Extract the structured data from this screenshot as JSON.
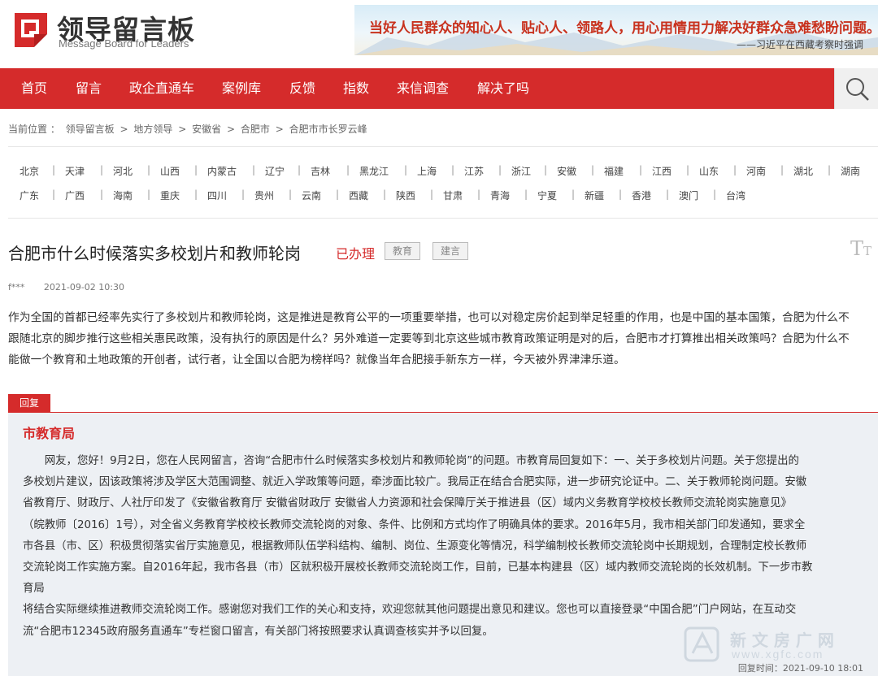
{
  "header": {
    "title": "领导留言板",
    "subtitle": "Message Board for Leaders",
    "slogan": "当好人民群众的知心人、贴心人、领路人，用心用情用力解决好群众急难愁盼问题。",
    "slogan_signature": "——习近平在西藏考察时强调"
  },
  "nav": {
    "items": [
      "首页",
      "留言",
      "政企直通车",
      "案例库",
      "反馈",
      "指数",
      "来信调查",
      "解决了吗"
    ]
  },
  "breadcrumb": {
    "prefix": "当前位置 ：",
    "items": [
      "领导留言板",
      "地方领导",
      "安徽省",
      "合肥市",
      "合肥市市长罗云峰"
    ],
    "separator": ">"
  },
  "provinces": {
    "row1": [
      "北京",
      "天津",
      "河北",
      "山西",
      "内蒙古",
      "辽宁",
      "吉林",
      "黑龙江",
      "上海",
      "江苏",
      "浙江",
      "安徽",
      "福建",
      "江西",
      "山东",
      "河南",
      "湖北",
      "湖南"
    ],
    "row2": [
      "广东",
      "广西",
      "海南",
      "重庆",
      "四川",
      "贵州",
      "云南",
      "西藏",
      "陕西",
      "甘肃",
      "青海",
      "宁夏",
      "新疆",
      "香港",
      "澳门",
      "台湾"
    ],
    "separator": "|"
  },
  "message": {
    "title": "合肥市什么时候落实多校划片和教师轮岗",
    "status": "已办理",
    "tags": [
      "教育",
      "建言"
    ],
    "author": "f***",
    "time": "2021-09-02 10:30",
    "lines": [
      "作为全国的首都已经率先实行了多校划片和教师轮岗，这是推进是教育公平的一项重要举措，也可以对稳定房价起到举足轻重的作用，也是中国的基本国策，合肥为什么不",
      "跟随北京的脚步推行这些相关惠民政策，没有执行的原因是什么？另外难道一定要等到北京这些城市教育政策证明是对的后，合肥市才打算推出相关政策吗？合肥为什么不",
      "能做一个教育和土地政策的开创者，试行者，让全国以合肥为榜样吗？就像当年合肥接手新东方一样，今天被外界津津乐道。"
    ]
  },
  "reply": {
    "label": "回复",
    "department": "市教育局",
    "lines": [
      "　　网友，您好！9月2日，您在人民网留言，咨询“合肥市什么时候落实多校划片和教师轮岗”的问题。市教育局回复如下：一、关于多校划片问题。关于您提出的",
      "多校划片建议，因该政策将涉及学区大范围调整、就近入学政策等问题，牵涉面比较广。我局正在结合合肥实际，进一步研究论证中。二、关于教师轮岗问题。安徽",
      "省教育厅、财政厅、人社厅印发了《安徽省教育厅 安徽省财政厅 安徽省人力资源和社会保障厅关于推进县（区）域内义务教育学校校长教师交流轮岗实施意见》",
      "（皖教师〔2016〕1号），对全省义务教育学校校长教师交流轮岗的对象、条件、比例和方式均作了明确具体的要求。2016年5月，我市相关部门印发通知，要求全",
      "市各县（市、区）积极贯彻落实省厅实施意见，根据教师队伍学科结构、编制、岗位、生源变化等情况，科学编制校长教师交流轮岗中长期规划，合理制定校长教师",
      "交流轮岗工作实施方案。自2016年起，我市各县（市）区就积极开展校长教师交流轮岗工作，目前，已基本构建县（区）域内教师交流轮岗的长效机制。下一步市教",
      "育局",
      "将结合实际继续推进教师交流轮岗工作。感谢您对我们工作的关心和支持，欢迎您就其他问题提出意见和建议。您也可以直接登录“中国合肥”门户网站，在互动交",
      "流“合肥市12345政府服务直通车”专栏窗口留言，有关部门将按照要求认真调查核实并予以回复。"
    ],
    "time_label": "回复时间：",
    "time": "2021-09-10 18:01"
  },
  "watermark": {
    "text": "新 文 房 广 网",
    "url": "www.xgfc.com"
  },
  "colors": {
    "brand_red": "#d52b2b",
    "reply_bg": "#edf0f4"
  },
  "icons": {
    "search": "search-icon",
    "font_size": "font-size-icon",
    "logo": "logo-mark-icon"
  }
}
